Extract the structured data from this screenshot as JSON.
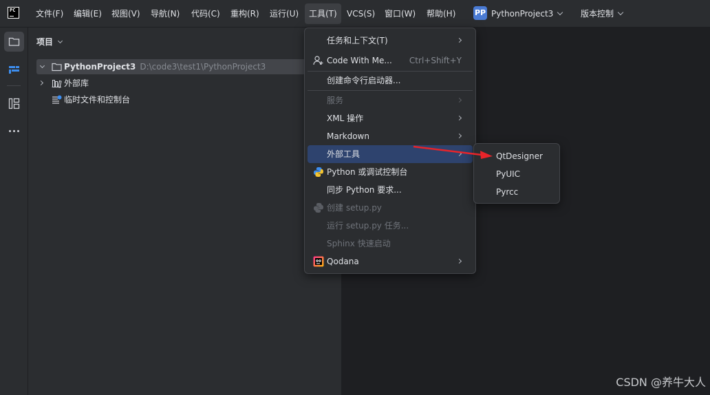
{
  "menubar": {
    "logo": "PC",
    "items": [
      "文件(F)",
      "编辑(E)",
      "视图(V)",
      "导航(N)",
      "代码(C)",
      "重构(R)",
      "运行(U)",
      "工具(T)",
      "VCS(S)",
      "窗口(W)",
      "帮助(H)"
    ],
    "project_badge": "PP",
    "project_name": "PythonProject3",
    "vcs_label": "版本控制"
  },
  "project_panel": {
    "title": "项目",
    "tree": [
      {
        "label": "PythonProject3",
        "path": "D:\\code3\\test1\\PythonProject3"
      },
      {
        "label": "外部库"
      },
      {
        "label": "临时文件和控制台"
      }
    ]
  },
  "tools_menu": {
    "items": [
      {
        "label": "任务和上下文(T)",
        "submenu": true
      },
      {
        "label": "Code With Me...",
        "shortcut": "Ctrl+Shift+Y"
      },
      {
        "label": "创建命令行启动器..."
      },
      {
        "label": "服务",
        "disabled": true,
        "submenu": true
      },
      {
        "label": "XML 操作",
        "submenu": true
      },
      {
        "label": "Markdown",
        "submenu": true
      },
      {
        "label": "外部工具",
        "submenu": true,
        "highlighted": true
      },
      {
        "label": "Python 或调试控制台"
      },
      {
        "label": "同步 Python 要求..."
      },
      {
        "label": "创建 setup.py",
        "disabled": true
      },
      {
        "label": "运行 setup.py 任务...",
        "disabled": true
      },
      {
        "label": "Sphinx 快速启动",
        "disabled": true
      },
      {
        "label": "Qodana",
        "submenu": true
      }
    ]
  },
  "external_tools_submenu": {
    "items": [
      "QtDesigner",
      "PyUIC",
      "Pyrcc"
    ]
  },
  "watermark": "CSDN @养牛大人",
  "colors": {
    "accent": "#2e436e",
    "arrow": "#e8242a",
    "background": "#1e1f22",
    "panel": "#2b2d30"
  }
}
